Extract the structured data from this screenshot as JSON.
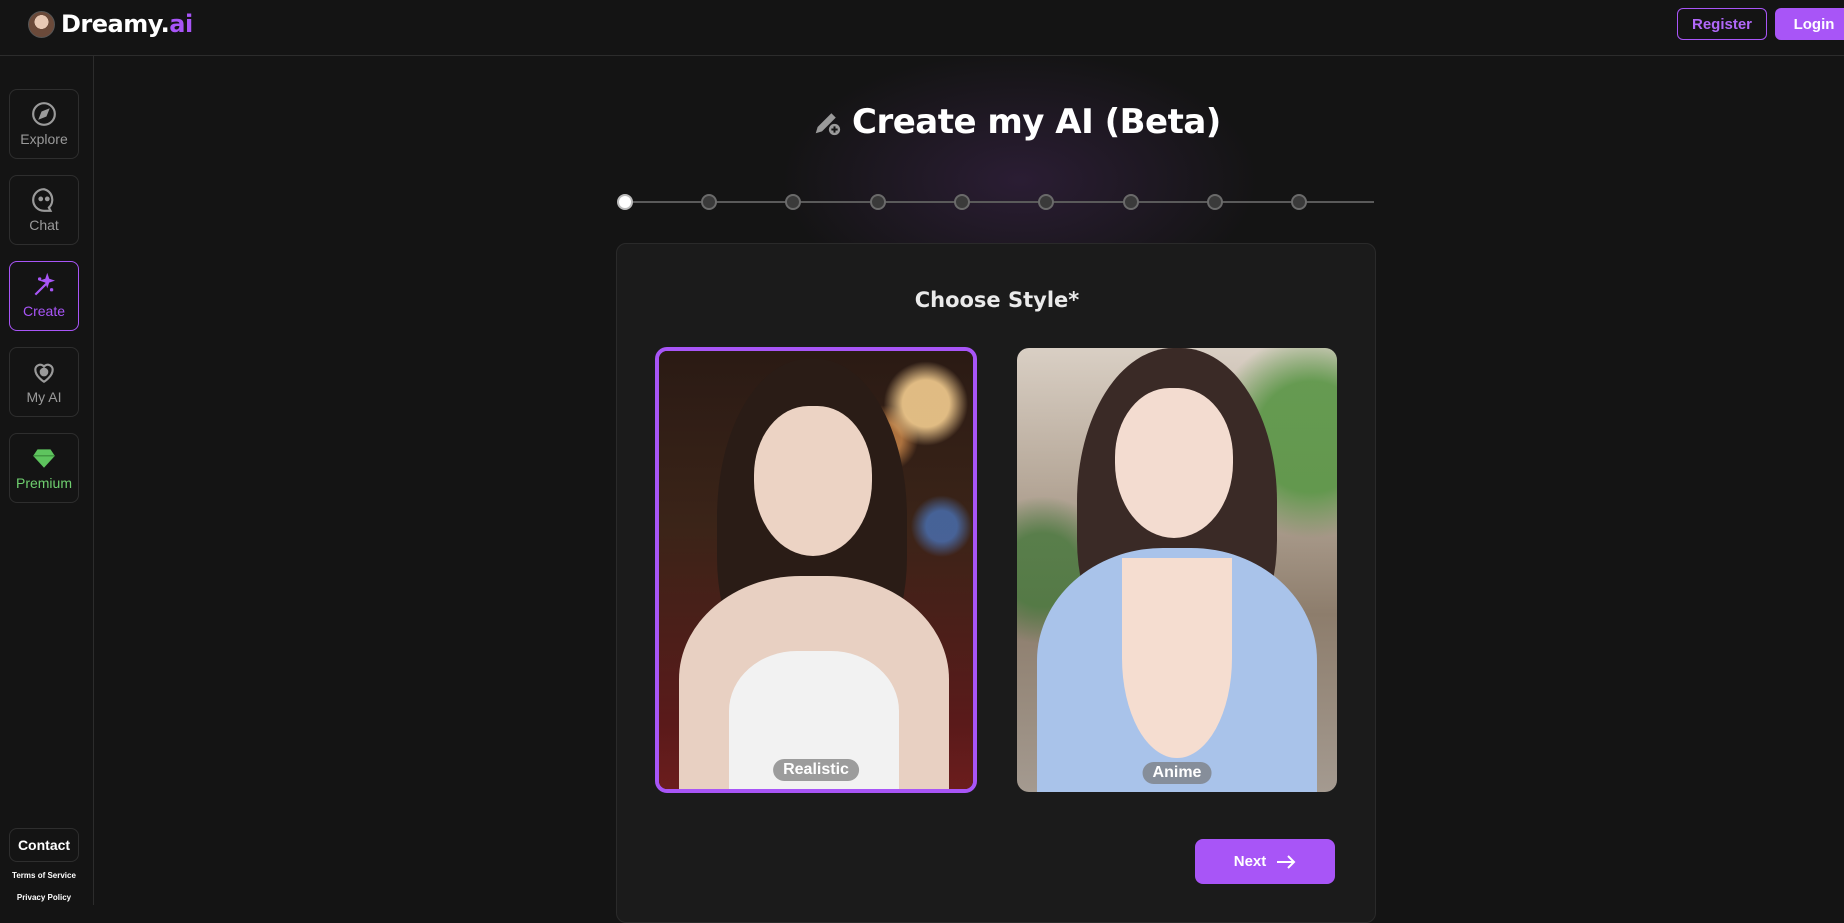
{
  "header": {
    "logo_text": "Dreamy.",
    "logo_accent": "ai",
    "register_label": "Register",
    "login_label": "Login"
  },
  "sidebar": {
    "items": [
      {
        "label": "Explore",
        "icon": "compass-icon"
      },
      {
        "label": "Chat",
        "icon": "chat-bubble-icon"
      },
      {
        "label": "Create",
        "icon": "magic-wand-icon",
        "active": true
      },
      {
        "label": "My AI",
        "icon": "heart-face-icon"
      },
      {
        "label": "Premium",
        "icon": "diamond-icon"
      }
    ],
    "contact_label": "Contact",
    "terms_label": "Terms of Service",
    "privacy_label": "Privacy Policy"
  },
  "main": {
    "title": "Create my AI (Beta)",
    "stepper": {
      "total_steps": 9,
      "current_step": 1
    },
    "card_title": "Choose Style*",
    "options": [
      {
        "label": "Realistic",
        "selected": true
      },
      {
        "label": "Anime",
        "selected": false
      }
    ],
    "next_label": "Next"
  },
  "colors": {
    "accent": "#a855f7",
    "premium": "#6fcf6f",
    "background": "#141414",
    "card": "#1b1b1b"
  }
}
